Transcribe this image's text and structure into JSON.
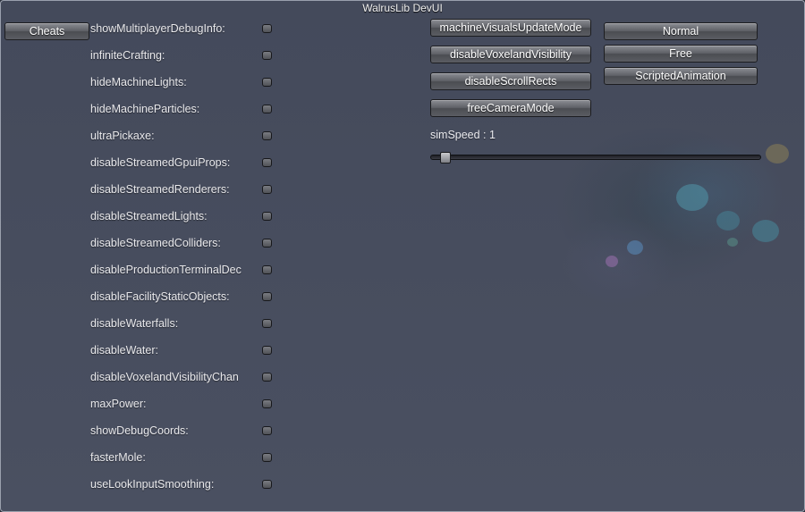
{
  "window": {
    "title": "WalrusLib DevUI"
  },
  "sidebar": {
    "cheats_label": "Cheats"
  },
  "settings": [
    {
      "label": "showMultiplayerDebugInfo:"
    },
    {
      "label": "infiniteCrafting:"
    },
    {
      "label": "hideMachineLights:"
    },
    {
      "label": "hideMachineParticles:"
    },
    {
      "label": "ultraPickaxe:"
    },
    {
      "label": "disableStreamedGpuiProps:"
    },
    {
      "label": "disableStreamedRenderers:"
    },
    {
      "label": "disableStreamedLights:"
    },
    {
      "label": "disableStreamedColliders:"
    },
    {
      "label": "disableProductionTerminalDec"
    },
    {
      "label": "disableFacilityStaticObjects:"
    },
    {
      "label": "disableWaterfalls:"
    },
    {
      "label": "disableWater:"
    },
    {
      "label": "disableVoxelandVisibilityChan"
    },
    {
      "label": "maxPower:"
    },
    {
      "label": "showDebugCoords:"
    },
    {
      "label": "fasterMole:"
    },
    {
      "label": "useLookInputSmoothing:"
    }
  ],
  "actions": {
    "machine_visuals": "machineVisualsUpdateMode",
    "disable_voxeland": "disableVoxelandVisibility",
    "disable_scroll": "disableScrollRects",
    "free_camera": "freeCameraMode"
  },
  "modes": {
    "normal": "Normal",
    "free": "Free",
    "scripted": "ScriptedAnimation"
  },
  "sim_speed": {
    "label": "simSpeed : 1",
    "value": 1,
    "slider_fraction": 0.03
  }
}
